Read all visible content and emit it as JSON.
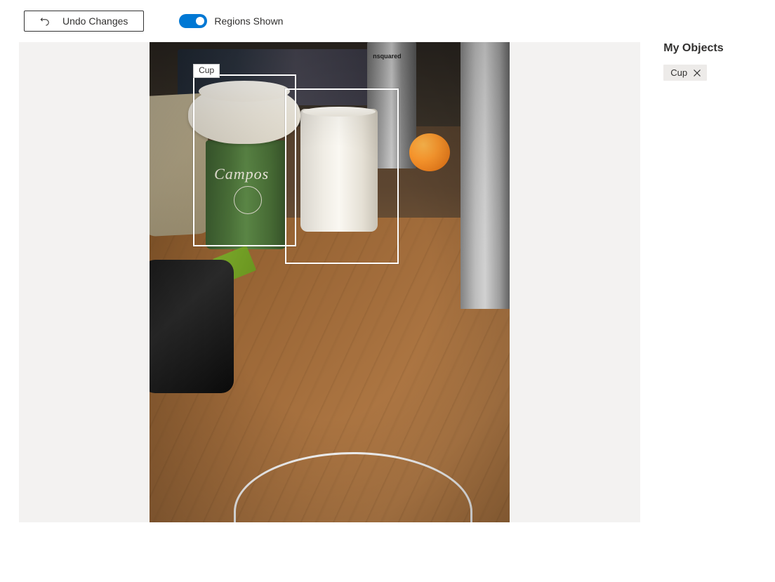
{
  "toolbar": {
    "undo_label": "Undo Changes",
    "toggle_label": "Regions Shown"
  },
  "image": {
    "regions": [
      {
        "label": "Cup"
      }
    ],
    "scene_text": {
      "campos": "Campos",
      "thermos": "nsquared"
    }
  },
  "sidebar": {
    "title": "My Objects",
    "objects": [
      {
        "name": "Cup"
      }
    ]
  }
}
